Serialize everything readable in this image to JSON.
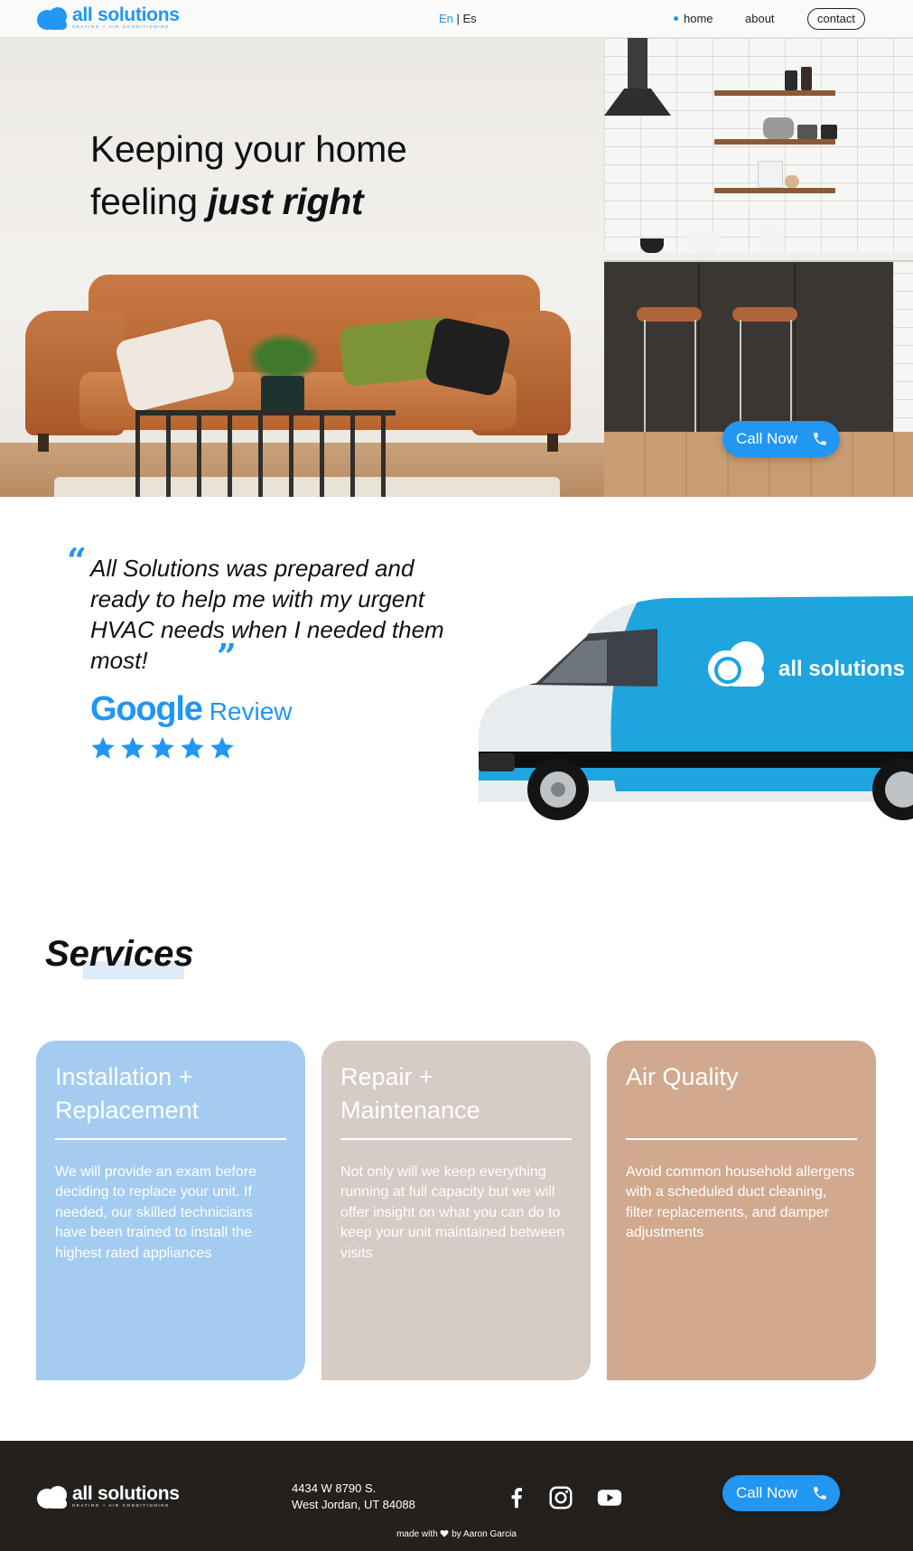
{
  "brand": {
    "name": "all solutions",
    "tagline": "HEATING + AIR CONDITIONING",
    "accent": "#2196f3"
  },
  "header": {
    "lang_en": "En",
    "lang_sep": " | ",
    "lang_es": "Es",
    "nav": {
      "home": "home",
      "about": "about",
      "contact": "contact"
    }
  },
  "hero": {
    "title_line1": "Keeping your home",
    "title_line2_a": "feeling ",
    "title_line2_b": "just right",
    "call_label": "Call Now"
  },
  "review": {
    "quote_open": "“",
    "quote": "All Solutions was prepared and ready to help me with my urgent HVAC needs when I needed them most!",
    "quote_close": "”",
    "source": "Google",
    "source_suffix": "Review",
    "rating": 5,
    "van_brand": "all solutions"
  },
  "services": {
    "title": "Services",
    "cards": [
      {
        "title": "Installation + Replacement",
        "text": "We will provide an exam before deciding to replace your unit. If needed, our skilled technicians have been trained to install the highest rated appliances",
        "color": "#a4ccf0"
      },
      {
        "title": "Repair + Maintenance",
        "text": "Not only will we keep everything running at full capacity but we will offer insight on what you can do to keep your unit maintained between visits",
        "color": "#d6cbc5"
      },
      {
        "title": "Air Quality",
        "text": "Avoid common household allergens with a scheduled duct cleaning, filter replacements, and damper adjustments",
        "color": "#d1a98e"
      }
    ]
  },
  "footer": {
    "address_line1": "4434 W 8790 S.",
    "address_line2": "West Jordan, UT 84088",
    "social": [
      "facebook-icon",
      "instagram-icon",
      "youtube-icon"
    ],
    "call_label": "Call Now",
    "made_prefix": "made with",
    "made_suffix": "by Aaron Garcia",
    "background": "#24201d"
  }
}
